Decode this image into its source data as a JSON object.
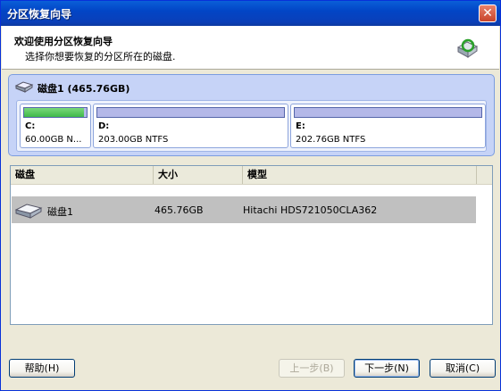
{
  "window": {
    "title": "分区恢复向导",
    "close_symbol": "✕"
  },
  "header": {
    "title": "欢迎使用分区恢复向导",
    "subtitle": "选择你想要恢复的分区所在的磁盘."
  },
  "disk": {
    "label": "磁盘1 (465.76GB)",
    "partitions": [
      {
        "letter": "C:",
        "info": "60.00GB N...",
        "used_fraction": 0.95,
        "bar_color": "#3fb84a"
      },
      {
        "letter": "D:",
        "info": "203.00GB NTFS",
        "used_fraction": 0,
        "bar_color": "#b4b8e8"
      },
      {
        "letter": "E:",
        "info": "202.76GB NTFS",
        "used_fraction": 0,
        "bar_color": "#b4b8e8"
      }
    ]
  },
  "list": {
    "columns": [
      "磁盘",
      "大小",
      "模型"
    ],
    "rows": [
      {
        "disk": "磁盘1",
        "size": "465.76GB",
        "model": "Hitachi HDS721050CLA362"
      }
    ]
  },
  "buttons": {
    "help": "帮助(H)",
    "back": "上一步(B)",
    "next": "下一步(N)",
    "cancel": "取消(C)"
  },
  "colors": {
    "titlebar": "#0245c6",
    "selected_row": "#c0c0c0",
    "panel": "#c6d3f7"
  }
}
